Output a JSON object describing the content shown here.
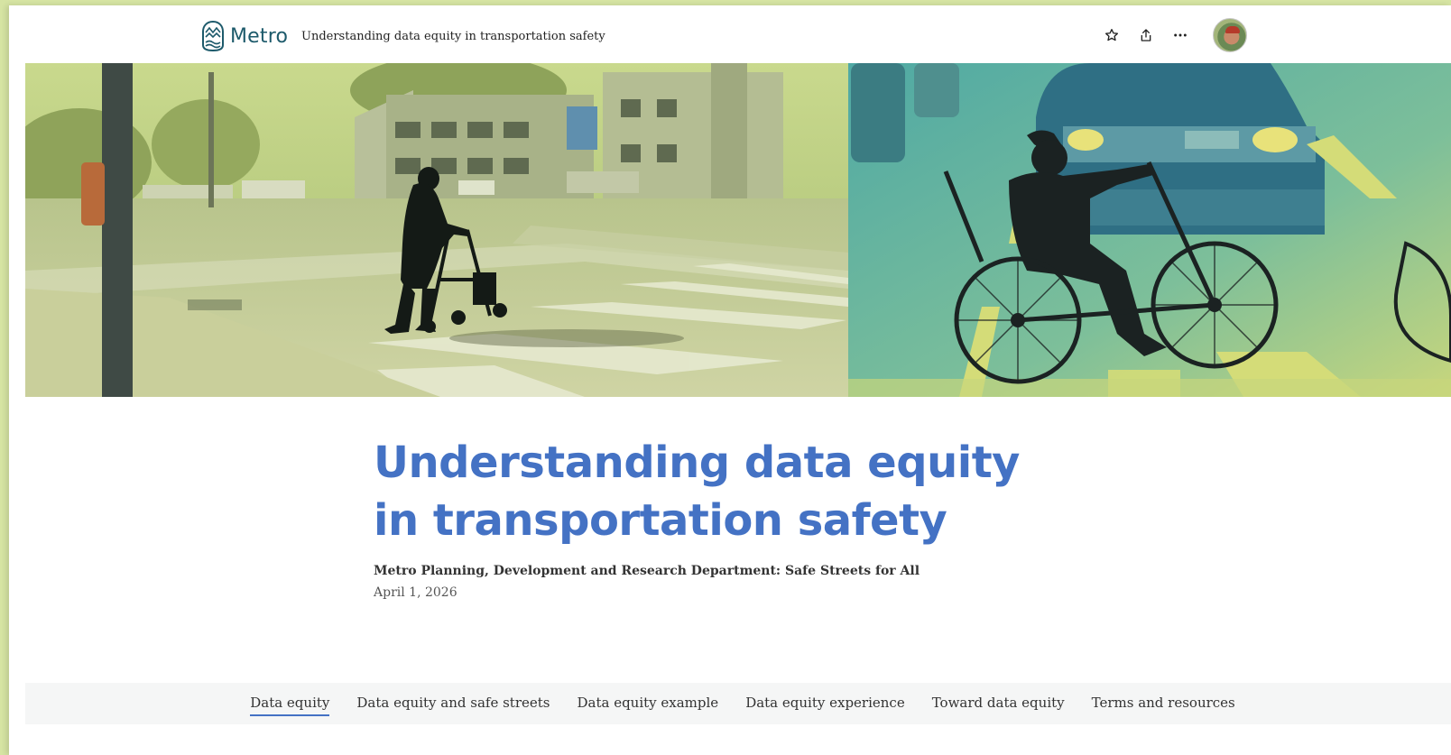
{
  "header": {
    "logo_text": "Metro",
    "story_title": "Understanding data equity in transportation safety",
    "actions": [
      {
        "name": "favorite",
        "icon": "star-icon"
      },
      {
        "name": "share",
        "icon": "share-icon"
      },
      {
        "name": "more",
        "icon": "more-icon"
      }
    ]
  },
  "hero": {
    "left_image": "person-with-walker-crossing-street",
    "right_image": "person-riding-handcycle-in-traffic"
  },
  "main": {
    "title_line1": "Understanding data equity",
    "title_line2": "in transportation safety",
    "byline": "Metro Planning, Development and Research Department: Safe Streets for All",
    "date": "April 1, 2026"
  },
  "nav": {
    "items": [
      {
        "label": "Data equity",
        "active": true
      },
      {
        "label": "Data equity and safe streets",
        "active": false
      },
      {
        "label": "Data equity example",
        "active": false
      },
      {
        "label": "Data equity experience",
        "active": false
      },
      {
        "label": "Toward data equity",
        "active": false
      },
      {
        "label": "Terms and resources",
        "active": false
      }
    ]
  },
  "colors": {
    "title": "#4472c4",
    "logo": "#1d5a6b",
    "page_bg": "#d6e4a3",
    "nav_bg": "#f5f6f6"
  }
}
